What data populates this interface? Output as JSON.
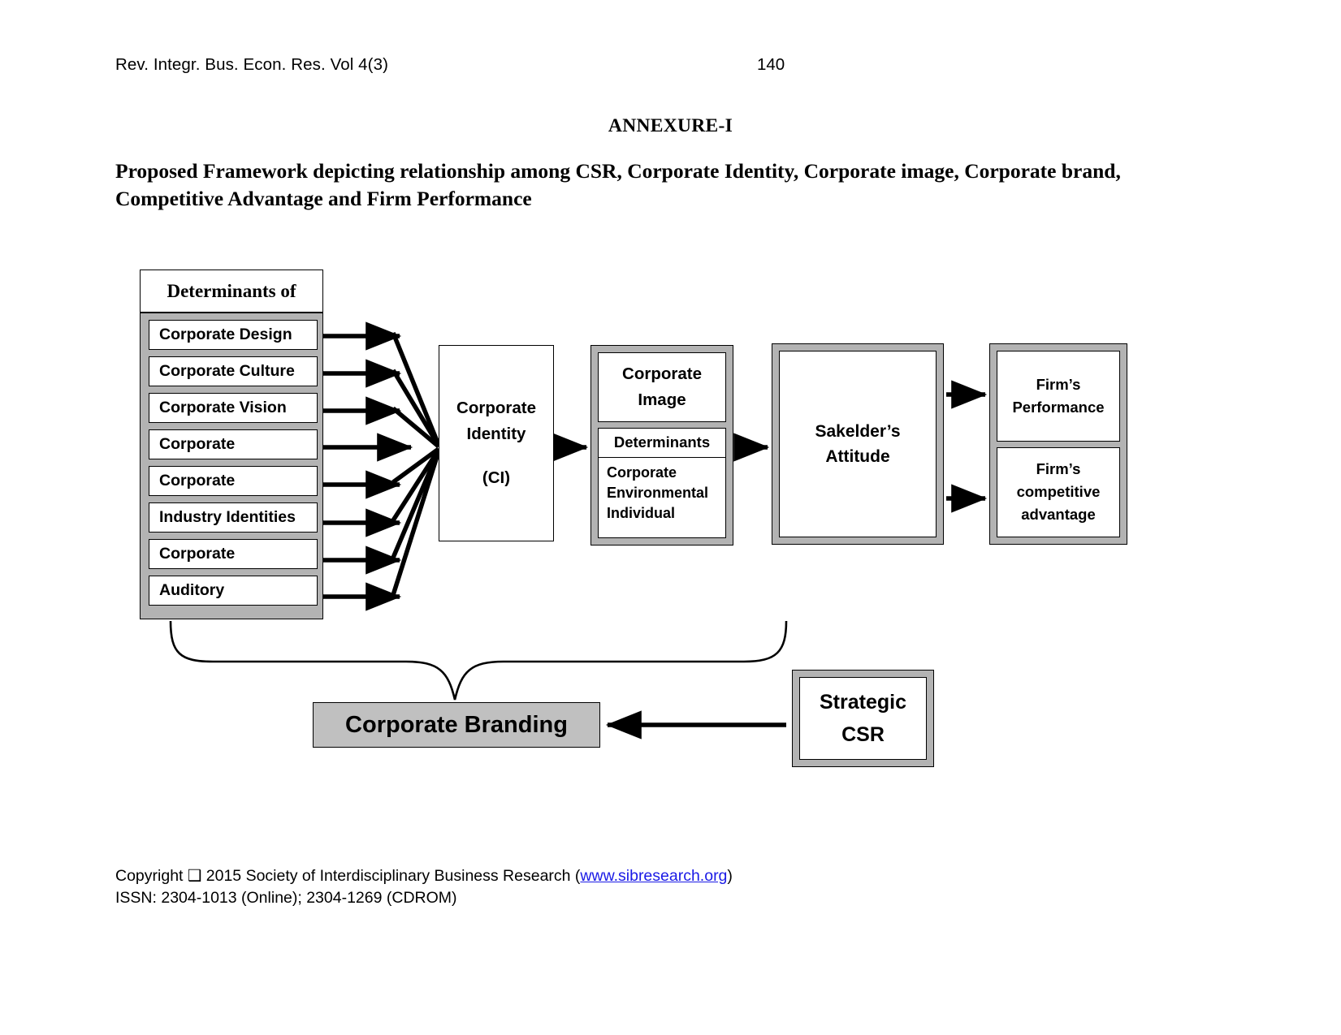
{
  "header": {
    "journal": "Rev. Integr. Bus. Econ. Res. Vol 4(3)",
    "page_number": "140"
  },
  "annexure_heading": "ANNEXURE-I",
  "framework_title": "Proposed Framework depicting relationship among CSR, Corporate Identity, Corporate  image, Corporate brand, Competitive Advantage and Firm Performance",
  "diagram": {
    "determinants": {
      "header": "Determinants of",
      "items": [
        {
          "label": "Corporate Design"
        },
        {
          "label": "Corporate Culture"
        },
        {
          "label": "Corporate Vision"
        },
        {
          "label": "Corporate"
        },
        {
          "label": "Corporate"
        },
        {
          "label": "Industry Identities"
        },
        {
          "label": "Corporate"
        },
        {
          "label": "Auditory"
        }
      ]
    },
    "corporate_identity": {
      "line1": "Corporate",
      "line2": "Identity",
      "abbrev": "(CI)"
    },
    "corporate_image": {
      "title_line1": "Corporate",
      "title_line2": "Image",
      "determinants_label": "Determinants",
      "determinants": [
        "Corporate",
        "Environmental",
        "Individual"
      ]
    },
    "sakelder_attitude": {
      "line1": "Sakelder’s",
      "line2": "Attitude"
    },
    "firm_outcomes": [
      {
        "line1": "Firm’s",
        "line2": "Performance",
        "line3": ""
      },
      {
        "line1": "Firm’s",
        "line2": "competitive",
        "line3": "advantage"
      }
    ],
    "corporate_branding": {
      "label": "Corporate Branding"
    },
    "strategic_csr": {
      "line1": "Strategic",
      "line2": "CSR"
    },
    "colors": {
      "box_frame_gray": "#b3b3b3",
      "branding_fill": "#c0c0c0",
      "stroke": "#000000",
      "link": "#1a1ae6"
    }
  },
  "footer": {
    "copyright_prefix": "Copyright ❑  2015 Society of Interdisciplinary Business Research (",
    "link_text": "www.sibresearch.org",
    "copyright_suffix": ")",
    "issn": "ISSN: 2304-1013 (Online); 2304-1269 (CDROM)"
  }
}
